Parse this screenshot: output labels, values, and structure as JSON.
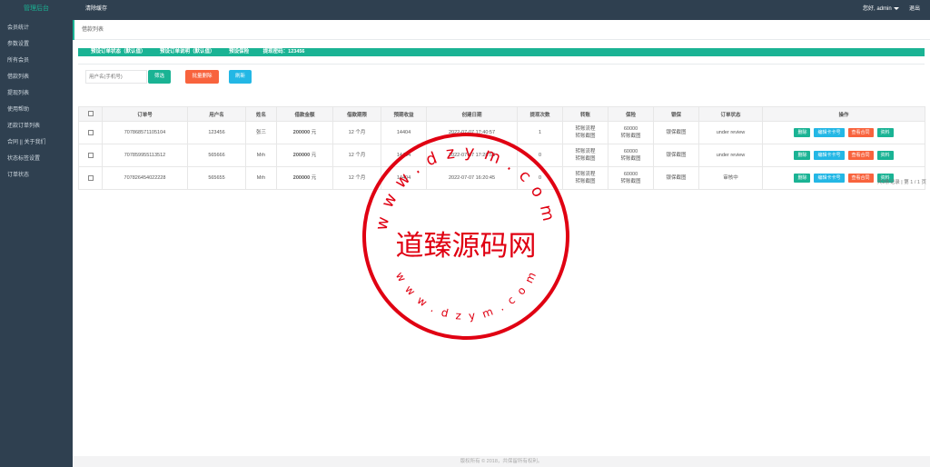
{
  "topbar": {
    "brand": "管理后台",
    "clear_cache": "清除缓存",
    "user_greeting": "您好, admin",
    "logout": "退出"
  },
  "sidebar": {
    "items": [
      {
        "label": "会员统计"
      },
      {
        "label": "参数设置"
      },
      {
        "label": "所有会员"
      },
      {
        "label": "借款列表"
      },
      {
        "label": "提现列表"
      },
      {
        "label": "使用帮助"
      },
      {
        "label": "还款订单列表"
      },
      {
        "label": "合同 || 关于我们"
      },
      {
        "label": "状态标签设置"
      },
      {
        "label": "订单状态"
      }
    ]
  },
  "tabbar": {
    "active_tab": "借款列表"
  },
  "banner": {
    "items": [
      "预设订单状态（默认值）",
      "预设订单说明（默认值）",
      "预设保险",
      "提现密码：123456"
    ]
  },
  "search": {
    "placeholder": "用户名(手机号)",
    "filter_label": "筛选",
    "batch_delete_label": "批量删除",
    "refresh_label": "刷新"
  },
  "table": {
    "headers": [
      "",
      "订单号",
      "用户名",
      "姓名",
      "借款金额",
      "借款期限",
      "预期收益",
      "创建日期",
      "提现次数",
      "转账",
      "保险",
      "银保",
      "订单状态",
      "操作"
    ],
    "rows": [
      {
        "order_no": "707868571105104",
        "username": "123456",
        "name": "张三",
        "amount": "200000",
        "amount_unit": "元",
        "term": "12",
        "term_unit": "个月",
        "expected": "14404",
        "created": "2022-07-07 17:40:57",
        "withdraw_count": "1",
        "transfer_line1": "转账流程",
        "transfer_line2": "转账截图",
        "insurance_line1": "60000",
        "insurance_line2": "转账截图",
        "bank_insurance": "银保截图",
        "status": "under review"
      },
      {
        "order_no": "707859955113512",
        "username": "565666",
        "name": "Mrh",
        "amount": "200000",
        "amount_unit": "元",
        "term": "12",
        "term_unit": "个月",
        "expected": "14404",
        "created": "2022-07-07 17:28:53",
        "withdraw_count": "0",
        "transfer_line1": "转账流程",
        "transfer_line2": "转账截图",
        "insurance_line1": "60000",
        "insurance_line2": "转账截图",
        "bank_insurance": "银保截图",
        "status": "under review"
      },
      {
        "order_no": "707826454022228",
        "username": "565655",
        "name": "Mrh",
        "amount": "200000",
        "amount_unit": "元",
        "term": "12",
        "term_unit": "个月",
        "expected": "14404",
        "created": "2022-07-07 16:20:45",
        "withdraw_count": "0",
        "transfer_line1": "转账流程",
        "transfer_line2": "转账截图",
        "insurance_line1": "60000",
        "insurance_line2": "转账截图",
        "bank_insurance": "银保截图",
        "status": "审核中"
      }
    ],
    "actions": {
      "delete": "删除",
      "edit": "编辑卡卡号",
      "contract": "查看合同",
      "data": "资料"
    }
  },
  "pager": {
    "text": "共3条记录 | 第 1 / 1 页"
  },
  "footer": {
    "text": "版权所有 © 2018，共保留所有权利。"
  },
  "watermark": {
    "title": "道臻源码网",
    "top_arc": "www.dzym.com",
    "bottom_arc": "www.dzym.com",
    "color": "#e00012"
  },
  "colors": {
    "sidebar_bg": "#2f4050",
    "accent": "#1ab394",
    "danger": "#f8633d",
    "info": "#23b7e5"
  }
}
